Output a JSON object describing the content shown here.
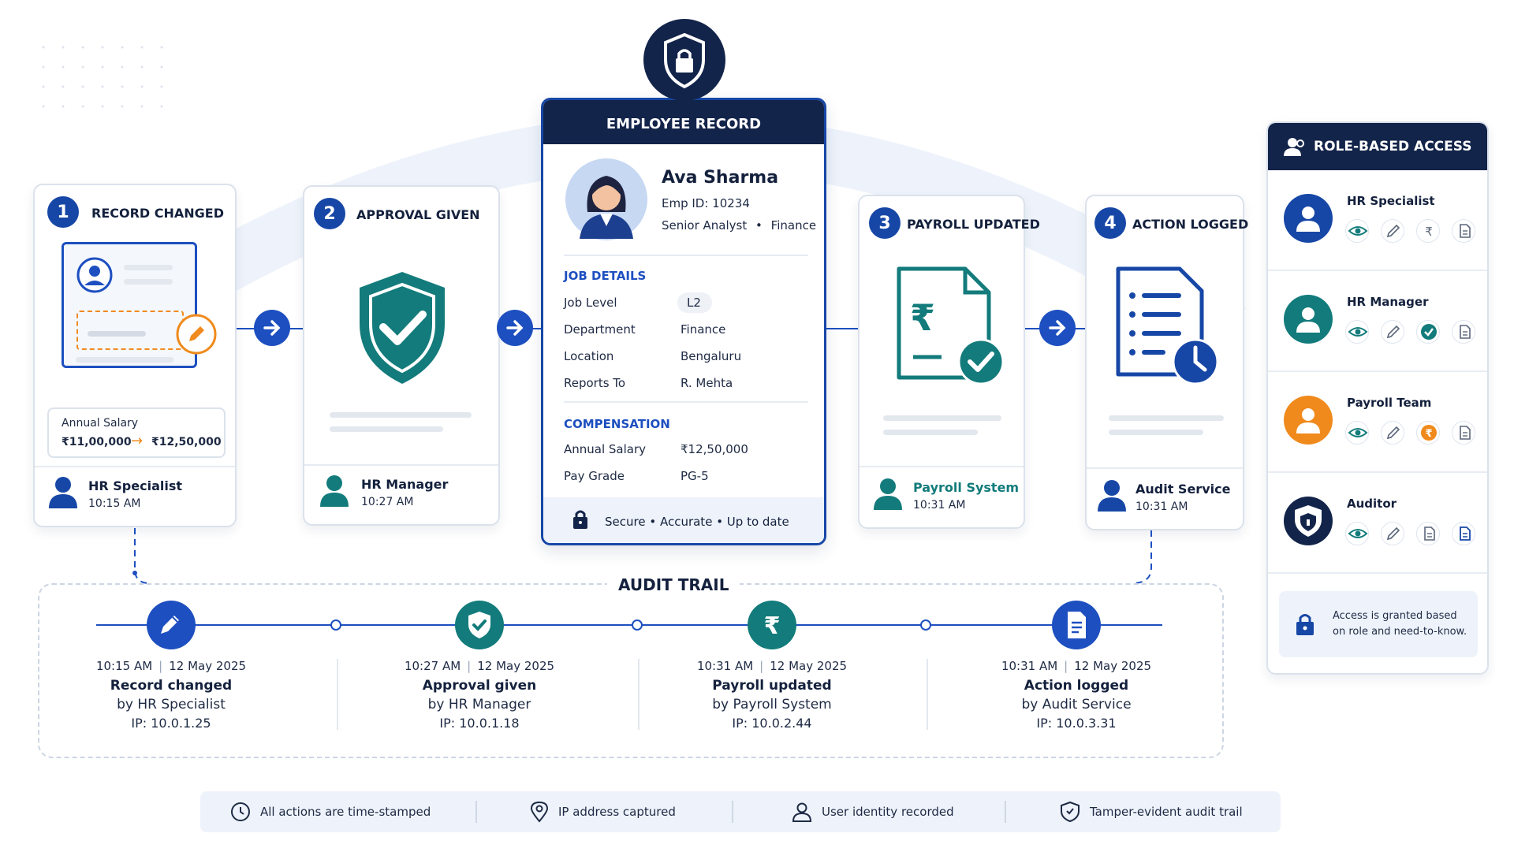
{
  "steps": [
    {
      "num": "1",
      "title": "RECORD CHANGED",
      "person": "HR Specialist",
      "time": "10:15 AM",
      "salary_label": "Annual Salary",
      "salary_from": "₹11,00,000",
      "salary_to": "₹12,50,000"
    },
    {
      "num": "2",
      "title": "APPROVAL GIVEN",
      "person": "HR Manager",
      "time": "10:27 AM"
    },
    {
      "num": "3",
      "title": "PAYROLL UPDATED",
      "person": "Payroll System",
      "time": "10:31 AM"
    },
    {
      "num": "4",
      "title": "ACTION LOGGED",
      "person": "Audit Service",
      "time": "10:31 AM"
    }
  ],
  "record": {
    "header": "EMPLOYEE RECORD",
    "name": "Ava Sharma",
    "emp_id": "Emp ID: 10234",
    "role": "Senior Analyst",
    "role_sep": "•",
    "dept": "Finance",
    "job_title": "JOB DETAILS",
    "job_rows": [
      {
        "label": "Job Level",
        "value": "L2"
      },
      {
        "label": "Department",
        "value": "Finance"
      },
      {
        "label": "Location",
        "value": "Bengaluru"
      },
      {
        "label": "Reports To",
        "value": "R. Mehta"
      }
    ],
    "comp_title": "COMPENSATION",
    "comp_rows": [
      {
        "label": "Annual Salary",
        "value": "₹12,50,000"
      },
      {
        "label": "Pay Grade",
        "value": "PG-5"
      }
    ],
    "footer": "Secure • Accurate • Up to date"
  },
  "rbac": {
    "title": "ROLE-BASED ACCESS",
    "roles": [
      {
        "name": "HR Specialist",
        "color": "#1747a6"
      },
      {
        "name": "HR Manager",
        "color": "#137b7b"
      },
      {
        "name": "Payroll Team",
        "color": "#f08a1c"
      },
      {
        "name": "Auditor",
        "color": "#13244a"
      }
    ],
    "note_line1": "Access is granted based",
    "note_line2": "on role and need-to-know."
  },
  "audit": {
    "title": "AUDIT TRAIL",
    "events": [
      {
        "time": "10:15 AM",
        "date": "12 May 2025",
        "action": "Record changed",
        "by": "by HR Specialist",
        "ip": "IP:  10.0.1.25",
        "color": "#1d4fc0",
        "icon": "pencil-icon"
      },
      {
        "time": "10:27 AM",
        "date": "12 May 2025",
        "action": "Approval given",
        "by": "by HR Manager",
        "ip": "IP:  10.0.1.18",
        "color": "#137b7b",
        "icon": "shield-check-icon"
      },
      {
        "time": "10:31 AM",
        "date": "12 May 2025",
        "action": "Payroll updated",
        "by": "by Payroll System",
        "ip": "IP:  10.0.2.44",
        "color": "#137b7b",
        "icon": "rupee-icon"
      },
      {
        "time": "10:31 AM",
        "date": "12 May 2025",
        "action": "Action logged",
        "by": "by Audit Service",
        "ip": "IP:  10.0.3.31",
        "color": "#1d4fc0",
        "icon": "document-icon"
      }
    ],
    "sep": "|"
  },
  "features": [
    {
      "label": "All actions are time-stamped",
      "icon": "clock-icon"
    },
    {
      "label": "IP address captured",
      "icon": "location-pin-icon"
    },
    {
      "label": "User identity recorded",
      "icon": "user-icon"
    },
    {
      "label": "Tamper-evident audit trail",
      "icon": "shield-icon"
    }
  ]
}
